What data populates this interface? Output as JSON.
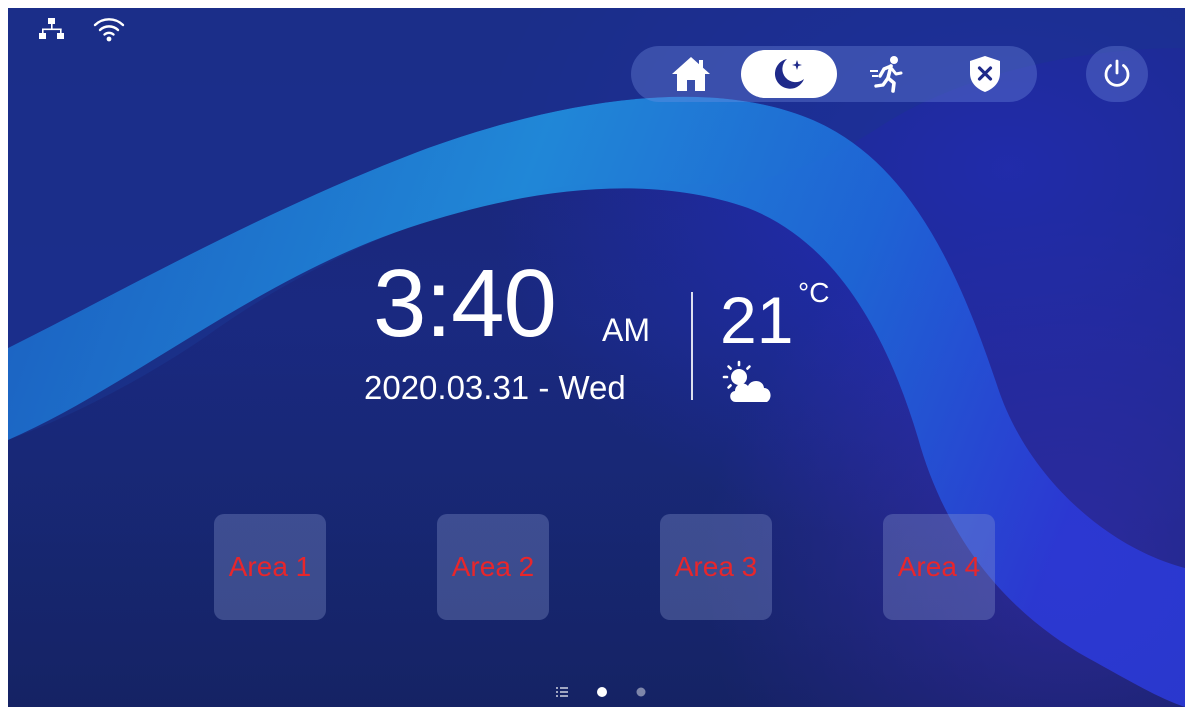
{
  "status_bar": {
    "icons": [
      "network-icon",
      "wifi-icon"
    ]
  },
  "mode_bar": {
    "modes": [
      {
        "name": "home-mode",
        "icon": "house-icon",
        "active": false
      },
      {
        "name": "sleep-mode",
        "icon": "moon-star-icon",
        "active": true
      },
      {
        "name": "away-mode",
        "icon": "running-person-icon",
        "active": false
      },
      {
        "name": "disarm-mode",
        "icon": "shield-x-icon",
        "active": false
      }
    ],
    "power_icon": "power-icon"
  },
  "clock": {
    "time": "3:40",
    "ampm": "AM",
    "date": "2020.03.31 - Wed"
  },
  "weather": {
    "temperature": "21",
    "unit": "°C",
    "icon": "partly-sunny-icon"
  },
  "areas": [
    {
      "label": "Area 1"
    },
    {
      "label": "Area 2"
    },
    {
      "label": "Area 3"
    },
    {
      "label": "Area 4"
    }
  ],
  "pager": {
    "pages": 2,
    "current": 1,
    "list_icon": "list-icon"
  },
  "colors": {
    "area_label": "#e8262b",
    "accent": "#1a237a"
  }
}
